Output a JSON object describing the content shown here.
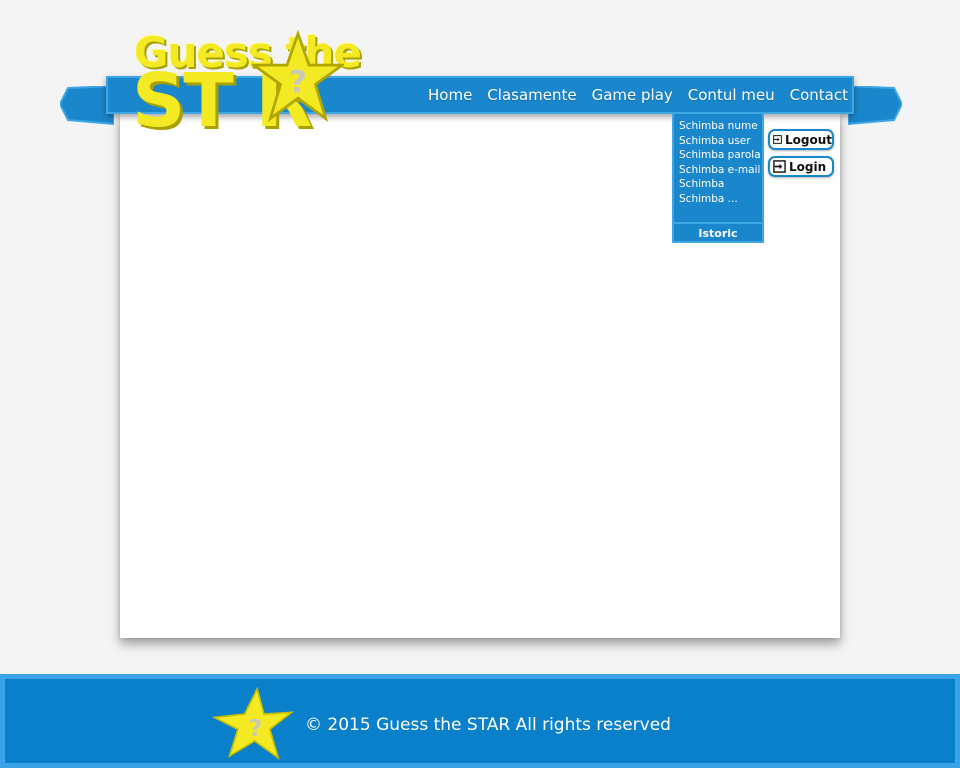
{
  "logo": {
    "line1": "Guess the",
    "line2": "ST R",
    "star_mark": "?"
  },
  "nav": {
    "items": [
      {
        "label": "Home"
      },
      {
        "label": "Clasamente"
      },
      {
        "label": "Game play"
      },
      {
        "label": "Contul meu"
      },
      {
        "label": "Contact"
      }
    ]
  },
  "account_menu": {
    "items": [
      {
        "label": "Schimba nume"
      },
      {
        "label": "Schimba user"
      },
      {
        "label": "Schimba parola"
      },
      {
        "label": "Schimba e-mail"
      },
      {
        "label": "Schimba"
      },
      {
        "label": "Schimba ..."
      }
    ],
    "footer_label": "Istoric"
  },
  "auth": {
    "logout_label": "Logout",
    "login_label": "Login",
    "icon": "sign-in-icon"
  },
  "footer": {
    "text": "© 2015 Guess the STAR All rights reserved",
    "star_mark": "?"
  },
  "colors": {
    "brand_blue": "#1a86cc",
    "border_blue": "#3fa6e6",
    "star_yellow": "#f3ea24",
    "page_bg": "#f4f4f4"
  }
}
